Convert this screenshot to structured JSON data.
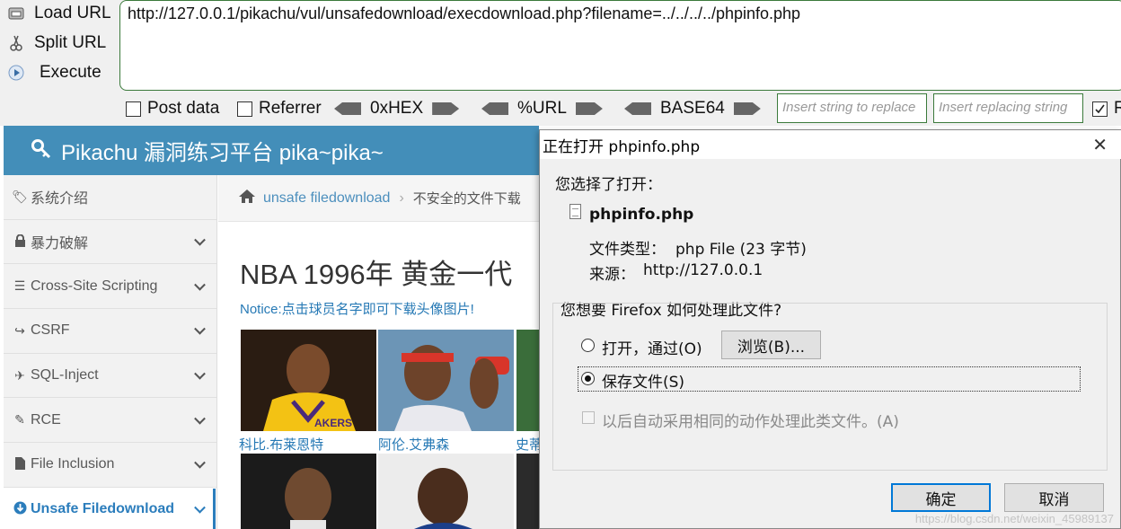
{
  "hackbar": {
    "actions": [
      {
        "label": "Load URL",
        "icon": "load-url-icon"
      },
      {
        "label": "Split URL",
        "icon": "scissors-icon"
      },
      {
        "label": "Execute",
        "icon": "play-icon"
      }
    ],
    "url": "http://127.0.0.1/pikachu/vul/unsafedownload/execdownload.php?filename=../../../../phpinfo.php",
    "options": {
      "post_data": "Post data",
      "referrer": "Referrer",
      "hex": "0xHEX",
      "url_enc": "%URL",
      "base64": "BASE64",
      "r_trail": "R"
    },
    "insert_placeholder": "Insert string to replace",
    "replacing_placeholder": "Insert replacing string"
  },
  "site": {
    "title": "Pikachu 漏洞练习平台 pika~pika~",
    "sidebar": [
      {
        "label": "系统介绍",
        "icon": "tag-icon",
        "chevron": false,
        "active": false
      },
      {
        "label": "暴力破解",
        "icon": "lock-icon",
        "chevron": true,
        "active": false
      },
      {
        "label": "Cross-Site Scripting",
        "icon": "list-icon",
        "chevron": true,
        "active": false
      },
      {
        "label": "CSRF",
        "icon": "share-icon",
        "chevron": true,
        "active": false
      },
      {
        "label": "SQL-Inject",
        "icon": "plane-icon",
        "chevron": true,
        "active": false
      },
      {
        "label": "RCE",
        "icon": "pencil-icon",
        "chevron": true,
        "active": false
      },
      {
        "label": "File Inclusion",
        "icon": "file-icon",
        "chevron": true,
        "active": false
      },
      {
        "label": "Unsafe Filedownload",
        "icon": "download-icon",
        "chevron": true,
        "active": true
      }
    ],
    "breadcrumb": {
      "link": "unsafe filedownload",
      "current": "不安全的文件下载"
    },
    "heading": "NBA 1996年 黄金一代",
    "notice": "Notice:点击球员名字即可下载头像图片!",
    "players": [
      "科比.布莱恩特",
      "阿伦.艾弗森",
      "史蒂"
    ]
  },
  "dialog": {
    "title": "正在打开 phpinfo.php",
    "chosen": "您选择了打开：",
    "filename": "phpinfo.php",
    "type_label": "文件类型：",
    "type_value": "php File (23 字节)",
    "source_label": "来源：",
    "source_value": "http://127.0.0.1",
    "question": "您想要 Firefox 如何处理此文件?",
    "open_with": "打开，通过(O)",
    "browse": "浏览(B)...",
    "save": "保存文件(S)",
    "auto": "以后自动采用相同的动作处理此类文件。(A)",
    "ok": "确定",
    "cancel": "取消"
  },
  "watermark": "https://blog.csdn.net/weixin_45989137",
  "colors": {
    "header_blue": "#438eb9",
    "link_blue": "#2679b5",
    "hackbar_green": "#3b7a3b"
  }
}
